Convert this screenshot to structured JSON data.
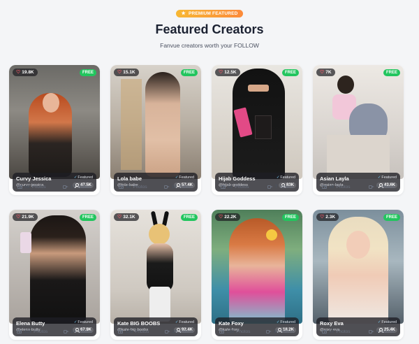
{
  "header": {
    "badge_label": "PREMIUM FEATURED",
    "title": "Featured Creators",
    "subtitle": "Fanvue creators worth your FOLLOW"
  },
  "colors": {
    "free": "#22c55e",
    "badge": "#f7b733",
    "heart": "#ff5b6b"
  },
  "creators": [
    {
      "likes": "19.8K",
      "free_label": "FREE",
      "name": "Curvy Jessica",
      "handle": "@curvy-jessica",
      "featured_label": "Featured",
      "subscribers": "47.5K",
      "photos": "68",
      "photos_label": "Photos",
      "videos": "17",
      "videos_label": "Videos"
    },
    {
      "likes": "15.1K",
      "free_label": "FREE",
      "name": "Lola babe",
      "handle": "@lola-babe",
      "featured_label": "Featured",
      "subscribers": "57.4K",
      "photos": "46",
      "photos_label": "Photos",
      "videos": "15",
      "videos_label": "Videos"
    },
    {
      "likes": "12.5K",
      "free_label": "FREE",
      "name": "Hijab Goddess",
      "handle": "@hijab-goddess",
      "featured_label": "Featured",
      "subscribers": "83K",
      "photos": "51",
      "photos_label": "Photos",
      "videos": "7",
      "videos_label": "Videos"
    },
    {
      "likes": "7K",
      "free_label": "FREE",
      "name": "Asian Layla",
      "handle": "@asian-layla",
      "featured_label": "Featured",
      "subscribers": "43.6K",
      "photos": "28",
      "photos_label": "Photos",
      "videos": "7",
      "videos_label": "Videos"
    },
    {
      "likes": "21.9K",
      "free_label": "FREE",
      "name": "Elena Butty",
      "handle": "@elena-butty",
      "featured_label": "Featured",
      "subscribers": "67.9K",
      "photos": "129",
      "photos_label": "Photos",
      "videos": "24",
      "videos_label": "Videos"
    },
    {
      "likes": "32.1K",
      "free_label": "FREE",
      "name": "Kate BIG BOOBS",
      "handle": "@kate-big-boobs",
      "featured_label": "Featured",
      "subscribers": "92.4K",
      "photos": "139",
      "photos_label": "Photos",
      "videos": "29",
      "videos_label": "Videos"
    },
    {
      "likes": "22.2K",
      "free_label": "FREE",
      "name": "Kate Foxy",
      "handle": "@kate-foxy",
      "featured_label": "Featured",
      "subscribers": "18.2K",
      "photos": "150",
      "photos_label": "Photos",
      "videos": "30",
      "videos_label": "Videos"
    },
    {
      "likes": "2.3K",
      "free_label": "FREE",
      "name": "Roxy Eva",
      "handle": "@roxy-eva",
      "featured_label": "Featured",
      "subscribers": "25.4K",
      "photos": "10",
      "photos_label": "Photos",
      "videos": "4",
      "videos_label": "Videos"
    }
  ]
}
